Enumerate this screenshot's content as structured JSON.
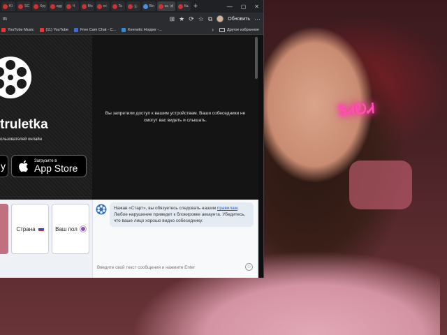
{
  "tabs": [
    {
      "label": "Ю"
    },
    {
      "label": "SC"
    },
    {
      "label": "Хру"
    },
    {
      "label": "sgg"
    },
    {
      "label": "Ч"
    },
    {
      "label": "Мо"
    },
    {
      "label": "ex"
    },
    {
      "label": "Ta"
    },
    {
      "label": "Ⓖ"
    },
    {
      "label": "Bio"
    },
    {
      "label": "ка"
    },
    {
      "label": "Ка"
    }
  ],
  "browser": {
    "address": "m",
    "refresh_label": "Обновить"
  },
  "bookmarks": [
    {
      "label": "YouTube Music",
      "color": "#e33"
    },
    {
      "label": "(11) YouTube",
      "color": "#e33"
    },
    {
      "label": "Free Cam Chat - C...",
      "color": "#3b6cd9"
    },
    {
      "label": "Keenetic Hopper -...",
      "color": "#2d8dd6"
    }
  ],
  "bookmarks_folder": "Другое избранное",
  "promo": {
    "brand": "truletka",
    "users_online": "ользователей онлайн",
    "appstore_small": "Загрузите в",
    "appstore_big": "App Store"
  },
  "video": {
    "access_message": "Вы запретили доступ к вашим устройствам. Ваши собеседники не смогут вас видеть и слышать."
  },
  "filters": {
    "country": "Страна",
    "gender": "Ваш пол"
  },
  "chat": {
    "msg_before": "Нажав «Старт», вы обязуетесь следовать нашим ",
    "rules_link": "правилам",
    "msg_after": ". Любое нарушение приведет к блокировке аккаунта. Убедитесь, что ваше лицо хорошо видно собеседнику.",
    "input_placeholder": "Введите свой текст сообщения и нажмите Enter"
  },
  "background": {
    "neon_sign": "ᏕᏗᎧᏗ"
  }
}
